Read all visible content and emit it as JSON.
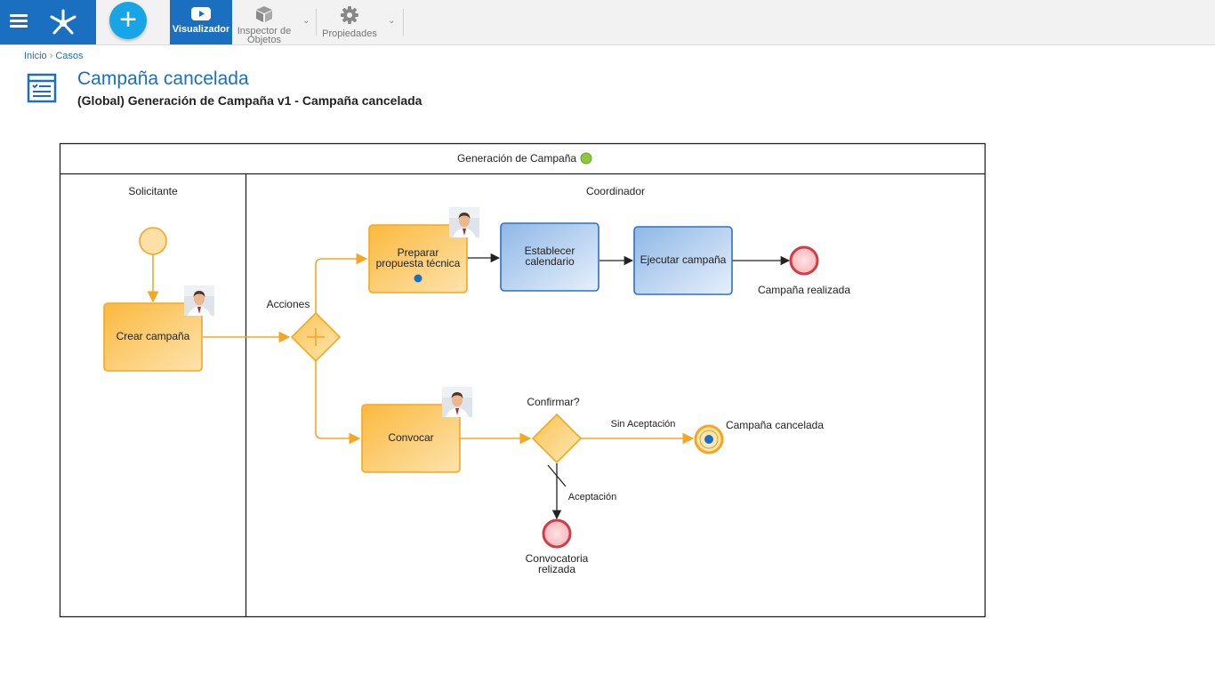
{
  "toolbar": {
    "visualizador": "Visualizador",
    "inspector_line1": "Inspector de",
    "inspector_line2": "Objetos",
    "propiedades": "Propiedades",
    "brand_color": "#1a6fc0",
    "add_color": "#17a5e6"
  },
  "breadcrumb": {
    "inicio": "Inicio",
    "separator": "›",
    "casos": "Casos"
  },
  "header": {
    "title": "Campaña cancelada",
    "subtitle": "(Global) Generación de Campaña v1 - Campaña cancelada"
  },
  "diagram": {
    "pool_title": "Generación de Campaña",
    "lanes": {
      "solicitante": "Solicitante",
      "coordinador": "Coordinador"
    },
    "tasks": {
      "crear": "Crear campaña",
      "preparar_l1": "Preparar",
      "preparar_l2": "propuesta técnica",
      "establecer_l1": "Establecer",
      "establecer_l2": "calendario",
      "ejecutar": "Ejecutar campaña",
      "convocar": "Convocar"
    },
    "gateways": {
      "acciones": "Acciones",
      "confirmar": "Confirmar?"
    },
    "flows": {
      "sin_aceptacion": "Sin Aceptación",
      "aceptacion": "Aceptación"
    },
    "events": {
      "realizada": "Campaña realizada",
      "cancelada": "Campaña cancelada",
      "convocatoria_l1": "Convocatoria",
      "convocatoria_l2": "relizada"
    },
    "colors": {
      "active_flow": "#f5a623",
      "task_orange_fill": "#fcc25a",
      "task_blue_fill": "#a9c8ea",
      "task_blue_stroke": "#2c72c0",
      "end_fill": "#f9c9cc",
      "end_stroke": "#d23c47"
    }
  }
}
